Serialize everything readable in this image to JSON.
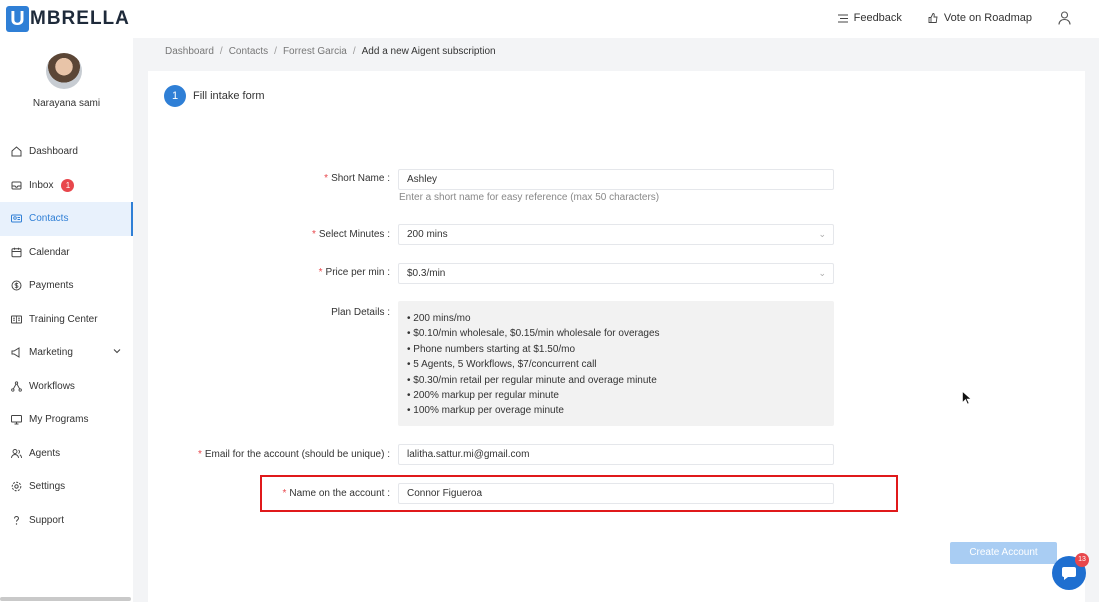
{
  "brand": {
    "logo_letter": "U",
    "name_rest": "MBRELLA",
    "accent": "#2f7fd6"
  },
  "topbar": {
    "feedback_label": "Feedback",
    "roadmap_label": "Vote on Roadmap"
  },
  "user": {
    "name": "Narayana sami"
  },
  "sidebar": {
    "items": [
      {
        "label": "Dashboard",
        "icon": "home-icon"
      },
      {
        "label": "Inbox",
        "icon": "inbox-icon",
        "badge": "1"
      },
      {
        "label": "Contacts",
        "icon": "contacts-icon",
        "active": true
      },
      {
        "label": "Calendar",
        "icon": "calendar-icon"
      },
      {
        "label": "Payments",
        "icon": "payments-icon"
      },
      {
        "label": "Training Center",
        "icon": "training-icon"
      },
      {
        "label": "Marketing",
        "icon": "marketing-icon",
        "expandable": true
      },
      {
        "label": "Workflows",
        "icon": "workflows-icon"
      },
      {
        "label": "My Programs",
        "icon": "programs-icon"
      },
      {
        "label": "Agents",
        "icon": "agents-icon"
      },
      {
        "label": "Settings",
        "icon": "settings-icon"
      },
      {
        "label": "Support",
        "icon": "support-icon"
      }
    ]
  },
  "breadcrumb": {
    "items": [
      "Dashboard",
      "Contacts",
      "Forrest Garcia"
    ],
    "current": "Add a new Aigent subscription"
  },
  "form": {
    "step_number": "1",
    "step_title": "Fill intake form",
    "short_name": {
      "label": "Short Name",
      "value": "Ashley",
      "hint": "Enter a short name for easy reference (max 50 characters)"
    },
    "minutes": {
      "label": "Select Minutes",
      "value": "200 mins"
    },
    "price": {
      "label": "Price per min",
      "value": "$0.3/min"
    },
    "plan": {
      "label": "Plan Details",
      "lines": [
        "200 mins/mo",
        "$0.10/min wholesale, $0.15/min wholesale for overages",
        "Phone numbers starting at $1.50/mo",
        "5 Agents, 5 Workflows, $7/concurrent call",
        "$0.30/min retail per regular minute and overage minute",
        "200% markup per regular minute",
        "100% markup per overage minute"
      ]
    },
    "email": {
      "label": "Email for the account (should be unique)",
      "value": "lalitha.sattur.mi@gmail.com"
    },
    "account_name": {
      "label": "Name on the account",
      "value": "Connor Figueroa"
    },
    "submit_label": "Create Account"
  },
  "chat": {
    "badge": "13"
  }
}
